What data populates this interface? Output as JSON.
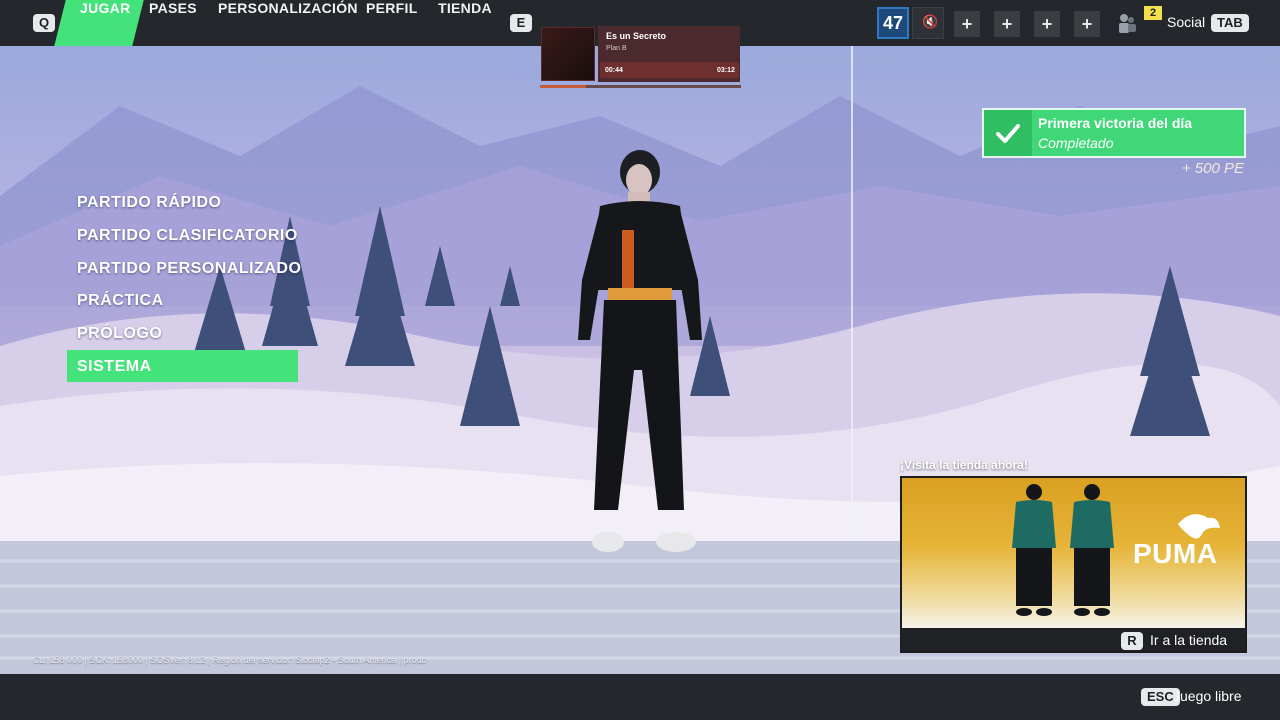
{
  "topbar": {
    "left_key": "Q",
    "right_key": "E",
    "tabs": [
      "JUGAR",
      "PASES",
      "PERSONALIZACIÓN",
      "PERFIL",
      "TIENDA"
    ],
    "level": "47",
    "party_slots": [
      "+",
      "+",
      "+",
      "+"
    ],
    "friends_online": "2",
    "social_label": "Social",
    "social_key": "TAB"
  },
  "music": {
    "song": "Es un Secreto",
    "artist": "Plan B",
    "elapsed": "00:44",
    "duration": "03:12",
    "progress": 0.23
  },
  "menu": {
    "items": [
      "PARTIDO RÁPIDO",
      "PARTIDO CLASIFICATORIO",
      "PARTIDO PERSONALIZADO",
      "PRÁCTICA",
      "PRÓLOGO",
      "SISTEMA"
    ],
    "selected": "SISTEMA"
  },
  "quest": {
    "title": "Primera victoria del día",
    "status": "Completado",
    "reward": "+ 500 PE"
  },
  "store_promo": {
    "label": "¡Visita la tienda ahora!",
    "brand": "PUMA",
    "action_key": "R",
    "action_label": "Ir a la tienda"
  },
  "debug_info": "CL: 158 000 | SCK: 158000 | SOSVer: 8.12 | Región del servidor: Sloclap2 - South America | prodb",
  "bottombar": {
    "key": "ESC",
    "label": "Juego libre"
  },
  "colors": {
    "accent": "#44e27b",
    "topbar": "#24282c",
    "level": "#2f79c2"
  }
}
